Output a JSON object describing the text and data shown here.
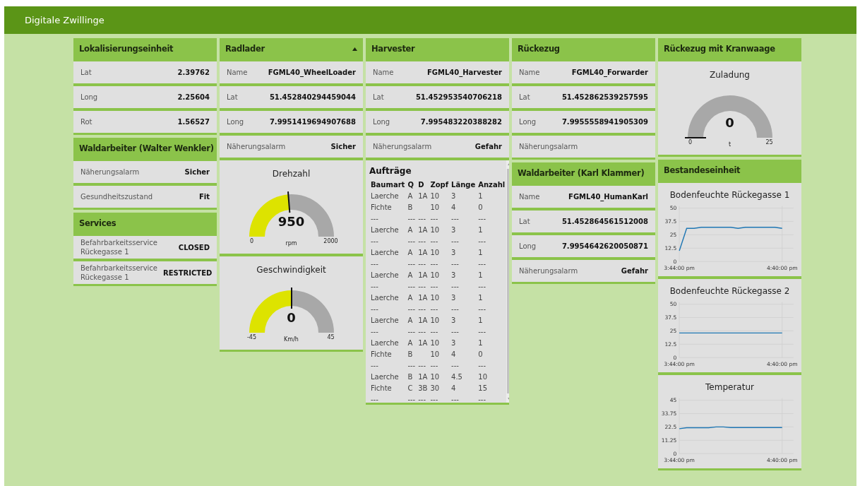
{
  "header": {
    "title": "Digitale Zwillinge"
  },
  "columns": [
    {
      "groups": [
        {
          "title": "Lokalisierungseinheit",
          "widgets": [
            {
              "kind": "text",
              "label": "Lat",
              "value": "2.39762"
            },
            {
              "kind": "text",
              "label": "Long",
              "value": "2.25604"
            },
            {
              "kind": "text",
              "label": "Rot",
              "value": "1.56527"
            }
          ]
        },
        {
          "title": "Waldarbeiter (Walter Wenkler)",
          "widgets": [
            {
              "kind": "text",
              "label": "Näherungsalarm",
              "value": "Sicher"
            },
            {
              "kind": "text",
              "label": "Gesundheitszustand",
              "value": "Fit"
            }
          ]
        },
        {
          "title": "Services",
          "widgets": [
            {
              "kind": "text",
              "label": "Befahrbarkeitsservice Rückegasse 1",
              "value": "CLOSED"
            },
            {
              "kind": "text",
              "label": "Befahrbarkeitsservice Rückegasse 1",
              "value": "RESTRICTED"
            }
          ]
        }
      ]
    },
    {
      "groups": [
        {
          "title": "Radlader",
          "expanded": true,
          "widgets": [
            {
              "kind": "text",
              "label": "Name",
              "value": "FGML40_WheelLoader"
            },
            {
              "kind": "text",
              "label": "Lat",
              "value": "51.452840294459044"
            },
            {
              "kind": "text",
              "label": "Long",
              "value": "7.9951419694907688"
            },
            {
              "kind": "text",
              "label": "Näherungsalarm",
              "value": "Sicher"
            },
            {
              "kind": "gauge",
              "title": "Drehzahl",
              "value": "950",
              "unit": "rpm",
              "min": "0",
              "max": "2000"
            },
            {
              "kind": "gauge",
              "title": "Geschwindigkeit",
              "value": "0",
              "unit": "Km/h",
              "min": "-45",
              "max": "45"
            }
          ]
        }
      ]
    },
    {
      "groups": [
        {
          "title": "Harvester",
          "widgets": [
            {
              "kind": "text",
              "label": "Name",
              "value": "FGML40_Harvester"
            },
            {
              "kind": "text",
              "label": "Lat",
              "value": "51.452953540706218"
            },
            {
              "kind": "text",
              "label": "Long",
              "value": "7.995483220388282"
            },
            {
              "kind": "text",
              "label": "Näherungsalarm",
              "value": "Gefahr"
            },
            {
              "kind": "table",
              "title": "Aufträge",
              "columns": [
                "Baumart",
                "Q",
                "D",
                "Zopf",
                "Länge",
                "Anzahl"
              ],
              "rows": [
                [
                  "Laerche",
                  "A",
                  "1A",
                  "10",
                  "3",
                  "1"
                ],
                [
                  "Fichte",
                  "B",
                  null,
                  "10",
                  "4",
                  "0"
                ],
                [
                  "---",
                  "---",
                  "---",
                  "---",
                  "---",
                  "---"
                ],
                [
                  "Laerche",
                  "A",
                  "1A",
                  "10",
                  "3",
                  "1"
                ],
                [
                  "---",
                  "---",
                  "---",
                  "---",
                  "---",
                  "---"
                ],
                [
                  "Laerche",
                  "A",
                  "1A",
                  "10",
                  "3",
                  "1"
                ],
                [
                  "---",
                  "---",
                  "---",
                  "---",
                  "---",
                  "---"
                ],
                [
                  "Laerche",
                  "A",
                  "1A",
                  "10",
                  "3",
                  "1"
                ],
                [
                  "---",
                  "---",
                  "---",
                  "---",
                  "---",
                  "---"
                ],
                [
                  "Laerche",
                  "A",
                  "1A",
                  "10",
                  "3",
                  "1"
                ],
                [
                  "---",
                  "---",
                  "---",
                  "---",
                  "---",
                  "---"
                ],
                [
                  "Laerche",
                  "A",
                  "1A",
                  "10",
                  "3",
                  "1"
                ],
                [
                  "---",
                  "---",
                  "---",
                  "---",
                  "---",
                  "---"
                ],
                [
                  "Laerche",
                  "A",
                  "1A",
                  "10",
                  "3",
                  "1"
                ],
                [
                  "Fichte",
                  "B",
                  null,
                  "10",
                  "4",
                  "0"
                ],
                [
                  "---",
                  "---",
                  "---",
                  "---",
                  "---",
                  "---"
                ],
                [
                  "Laerche",
                  "B",
                  "1A",
                  "10",
                  "4.5",
                  "10"
                ],
                [
                  "Fichte",
                  "C",
                  "3B",
                  "30",
                  "4",
                  "15"
                ],
                [
                  "---",
                  "---",
                  "---",
                  "---",
                  "---",
                  "---"
                ]
              ]
            }
          ]
        }
      ]
    },
    {
      "groups": [
        {
          "title": "Rückezug",
          "widgets": [
            {
              "kind": "text",
              "label": "Name",
              "value": "FGML40_Forwarder"
            },
            {
              "kind": "text",
              "label": "Lat",
              "value": "51.452862539257595"
            },
            {
              "kind": "text",
              "label": "Long",
              "value": "7.9955558941905309"
            },
            {
              "kind": "text",
              "label": "Näherungsalarm"
            }
          ]
        },
        {
          "title": "Waldarbeiter (Karl Klammer)",
          "widgets": [
            {
              "kind": "text",
              "label": "Name",
              "value": "FGML40_HumanKarl"
            },
            {
              "kind": "text",
              "label": "Lat",
              "value": "51.452864561512008"
            },
            {
              "kind": "text",
              "label": "Long",
              "value": "7.9954642620050871"
            },
            {
              "kind": "text",
              "label": "Näherungsalarm",
              "value": "Gefahr"
            }
          ]
        }
      ]
    },
    {
      "groups": [
        {
          "title": "Rückezug mit Kranwaage",
          "widgets": [
            {
              "kind": "gauge",
              "title": "Zuladung",
              "value": "0",
              "unit": "t",
              "min": "0",
              "max": "25"
            }
          ]
        },
        {
          "title": "Bestandeseinheit",
          "widgets": [
            {
              "kind": "chart",
              "chart_data": {
                "type": "line",
                "title": "Bodenfeuchte Rückegasse 1",
                "categories": [
                  "3:44:00 pm",
                  null,
                  null,
                  null,
                  null,
                  null,
                  null,
                  null,
                  null,
                  null,
                  null,
                  null,
                  null,
                  null,
                  "4:40:00 pm"
                ],
                "grid": true,
                "series": [
                  {
                    "color": "#1f77b4",
                    "values": [
                      10,
                      31,
                      31,
                      32,
                      32,
                      32,
                      32,
                      32,
                      31,
                      32,
                      32,
                      32,
                      32,
                      32,
                      31
                    ]
                  }
                ],
                "ylim": [
                  0,
                  50
                ],
                "yticks": [
                  {
                    "value": 0,
                    "label": "0"
                  },
                  {
                    "value": 12.5,
                    "label": "12.5"
                  },
                  {
                    "value": 25,
                    "label": "25"
                  },
                  {
                    "value": 37.5,
                    "label": "37.5"
                  },
                  {
                    "value": 50,
                    "label": "50"
                  }
                ]
              }
            },
            {
              "kind": "chart",
              "chart_data": {
                "type": "line",
                "title": "Bodenfeuchte Rückegasse 2",
                "categories": [
                  "3:44:00 pm",
                  null,
                  null,
                  null,
                  null,
                  null,
                  null,
                  null,
                  null,
                  null,
                  null,
                  null,
                  null,
                  null,
                  "4:40:00 pm"
                ],
                "grid": true,
                "series": [
                  {
                    "color": "#1f77b4",
                    "values": [
                      23,
                      23,
                      23,
                      23,
                      23,
                      23,
                      23,
                      23,
                      23,
                      23,
                      23,
                      23,
                      23,
                      23,
                      23
                    ]
                  }
                ],
                "ylim": [
                  0,
                  50
                ],
                "yticks": [
                  {
                    "value": 0,
                    "label": "0"
                  },
                  {
                    "value": 12.5,
                    "label": "12.5"
                  },
                  {
                    "value": 25,
                    "label": "25"
                  },
                  {
                    "value": 37.5,
                    "label": "37.5"
                  },
                  {
                    "value": 50,
                    "label": "50"
                  }
                ]
              }
            },
            {
              "kind": "chart",
              "chart_data": {
                "type": "line",
                "title": "Temperatur",
                "categories": [
                  "3:44:00 pm",
                  null,
                  null,
                  null,
                  null,
                  null,
                  null,
                  null,
                  null,
                  null,
                  null,
                  null,
                  null,
                  null,
                  "4:40:00 pm"
                ],
                "grid": true,
                "series": [
                  {
                    "color": "#1f77b4",
                    "values": [
                      21,
                      21.8,
                      21.8,
                      21.8,
                      21.8,
                      22.5,
                      22.5,
                      22,
                      22,
                      22,
                      22,
                      22,
                      22,
                      22,
                      22
                    ]
                  }
                ],
                "ylim": [
                  0,
                  45
                ],
                "yticks": [
                  {
                    "value": 0,
                    "label": "0"
                  },
                  {
                    "value": 11.25,
                    "label": "11.25"
                  },
                  {
                    "value": 22.5,
                    "label": "22.5"
                  },
                  {
                    "value": 33.75,
                    "label": "33.75"
                  },
                  {
                    "value": 45,
                    "label": "45"
                  }
                ]
              }
            }
          ]
        }
      ]
    }
  ]
}
